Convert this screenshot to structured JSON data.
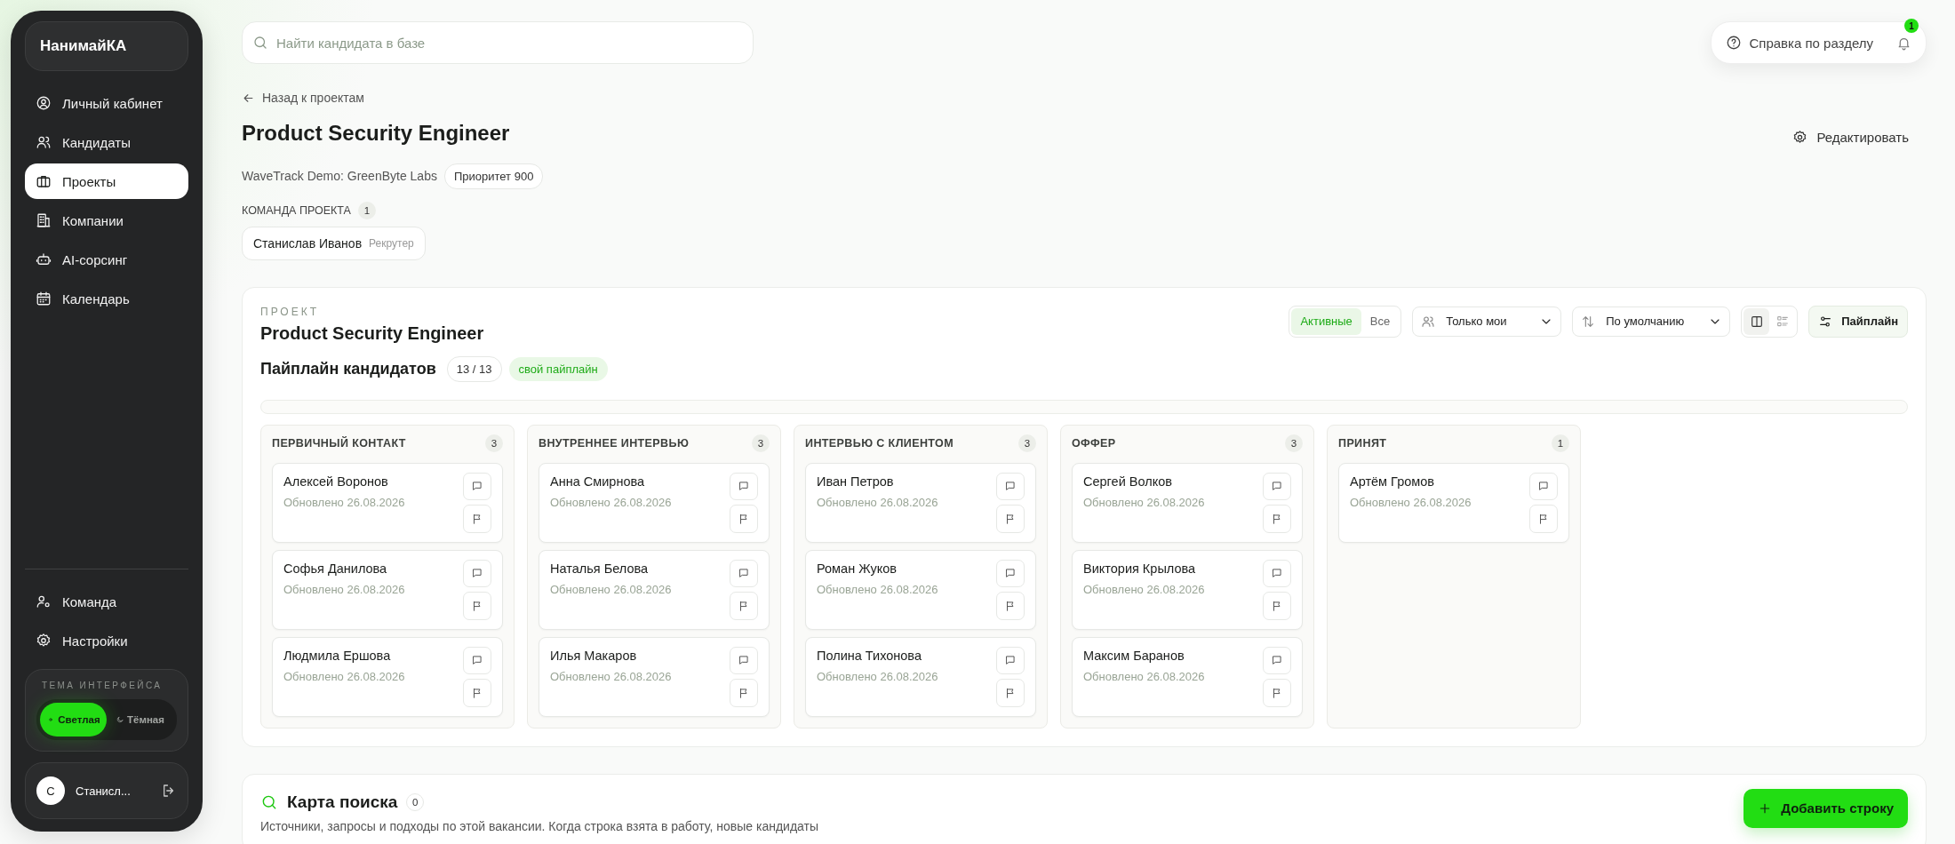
{
  "sidebar": {
    "brand": "НанимайКА",
    "nav": [
      {
        "label": "Личный кабинет",
        "selected": false
      },
      {
        "label": "Кандидаты",
        "selected": false
      },
      {
        "label": "Проекты",
        "selected": true
      },
      {
        "label": "Компании",
        "selected": false
      },
      {
        "label": "AI-сорсинг",
        "selected": false
      },
      {
        "label": "Календарь",
        "selected": false
      }
    ],
    "bottom_nav": [
      {
        "label": "Команда",
        "selected": false
      },
      {
        "label": "Настройки",
        "selected": false
      }
    ],
    "theme": {
      "title": "ТЕМА ИНТЕРФЕЙСА",
      "options": [
        {
          "label": "Светлая",
          "kind": "sun",
          "selected": true
        },
        {
          "label": "Тёмная",
          "kind": "moon",
          "selected": false
        }
      ]
    },
    "user": {
      "initial": "С",
      "name": "Станисл..."
    }
  },
  "search": {
    "placeholder": "Найти кандидата в базе"
  },
  "help": {
    "label": "Справка по разделу"
  },
  "notifications": {
    "count": "1"
  },
  "back_link": "Назад к проектам",
  "title": "Product Security Engineer",
  "edit_button": "Редактировать",
  "company": "WaveTrack Demo: GreenByte Labs",
  "priority": "Приоритет 900",
  "team": {
    "label": "КОМАНДА ПРОЕКТА",
    "count": "1",
    "members": [
      {
        "name": "Станислав Иванов",
        "role": "Рекрутер"
      }
    ]
  },
  "pipeline": {
    "eyebrow": "ПРОЕКТ",
    "title": "Product Security Engineer",
    "heading": "Пайплайн кандидатов",
    "count": "13 / 13",
    "tag": "свой пайплайн",
    "filter_tabs": [
      {
        "label": "Активные",
        "selected": true
      },
      {
        "label": "Все",
        "selected": false
      }
    ],
    "owner_select": "Только мои",
    "sort_select": "По умолчанию",
    "views": [
      {
        "kind": "board",
        "selected": true
      },
      {
        "kind": "list",
        "selected": false
      }
    ],
    "settings_button": "Пайплайн",
    "columns": [
      {
        "title": "ПЕРВИЧНЫЙ КОНТАКТ",
        "count": "3",
        "cards": [
          {
            "name": "Алексей Воронов",
            "updated": "Обновлено 26.08.2026"
          },
          {
            "name": "Софья Данилова",
            "updated": "Обновлено 26.08.2026"
          },
          {
            "name": "Людмила Ершова",
            "updated": "Обновлено 26.08.2026"
          }
        ]
      },
      {
        "title": "ВНУТРЕННЕЕ ИНТЕРВЬЮ",
        "count": "3",
        "cards": [
          {
            "name": "Анна Смирнова",
            "updated": "Обновлено 26.08.2026"
          },
          {
            "name": "Наталья Белова",
            "updated": "Обновлено 26.08.2026"
          },
          {
            "name": "Илья Макаров",
            "updated": "Обновлено 26.08.2026"
          }
        ]
      },
      {
        "title": "ИНТЕРВЬЮ С КЛИЕНТОМ",
        "count": "3",
        "cards": [
          {
            "name": "Иван Петров",
            "updated": "Обновлено 26.08.2026"
          },
          {
            "name": "Роман Жуков",
            "updated": "Обновлено 26.08.2026"
          },
          {
            "name": "Полина Тихонова",
            "updated": "Обновлено 26.08.2026"
          }
        ]
      },
      {
        "title": "ОФФЕР",
        "count": "3",
        "cards": [
          {
            "name": "Сергей Волков",
            "updated": "Обновлено 26.08.2026"
          },
          {
            "name": "Виктория Крылова",
            "updated": "Обновлено 26.08.2026"
          },
          {
            "name": "Максим Баранов",
            "updated": "Обновлено 26.08.2026"
          }
        ]
      },
      {
        "title": "ПРИНЯТ",
        "count": "1",
        "cards": [
          {
            "name": "Артём Громов",
            "updated": "Обновлено 26.08.2026"
          }
        ]
      }
    ]
  },
  "search_map": {
    "title": "Карта поиска",
    "count": "0",
    "description": "Источники, запросы и подходы по этой вакансии. Когда строка взята в работу, новые кандидаты",
    "add_button": "Добавить строку"
  }
}
